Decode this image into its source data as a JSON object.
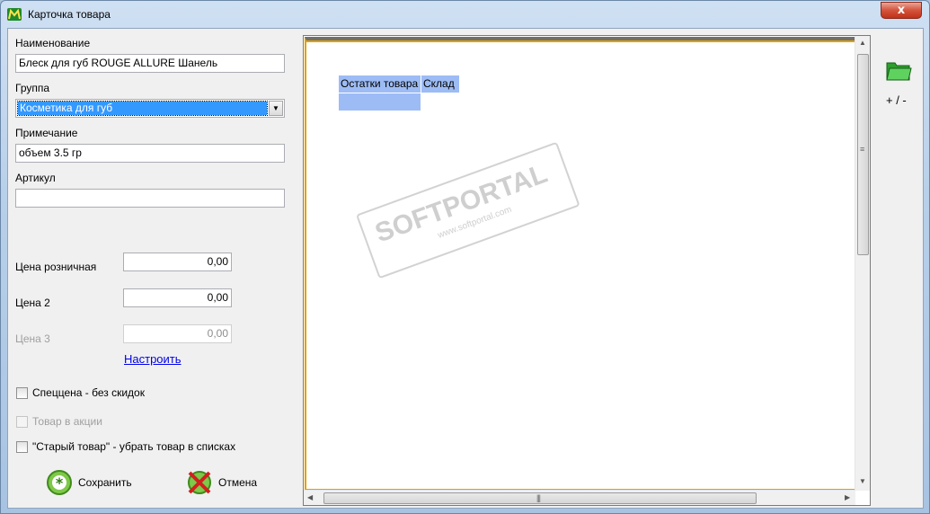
{
  "window": {
    "title": "Карточка товара",
    "close_label": "x"
  },
  "form": {
    "name_label": "Наименование",
    "name_value": "Блеск для губ ROUGE ALLURE Шанель",
    "group_label": "Группа",
    "group_value": "Косметика для губ",
    "note_label": "Примечание",
    "note_value": "объем 3.5 гр",
    "article_label": "Артикул",
    "article_value": "",
    "retail_price_label": "Цена розничная",
    "retail_price_value": "0,00",
    "price2_label": "Цена 2",
    "price2_value": "0,00",
    "price3_label": "Цена 3",
    "price3_value": "0,00",
    "configure_link": "Настроить",
    "special_price_label": "Спеццена - без скидок",
    "special_price_checked": false,
    "promo_label": "Товар в акции",
    "promo_checked": false,
    "old_item_label": "\"Старый товар\" - убрать товар в списках",
    "old_item_checked": false
  },
  "buttons": {
    "save_label": "Сохранить",
    "cancel_label": "Отмена"
  },
  "stock_grid": {
    "columns": [
      "Остатки товара",
      "Склад"
    ],
    "rows": [
      [
        "",
        ""
      ]
    ]
  },
  "side": {
    "folder_label": "+ / -"
  },
  "watermark": {
    "brand": "SOFTPORTAL",
    "url": "www.softportal.com"
  },
  "colors": {
    "selection": "#3399ff",
    "grid_header": "#9dbcf5",
    "frame_accent": "#e0a000"
  }
}
